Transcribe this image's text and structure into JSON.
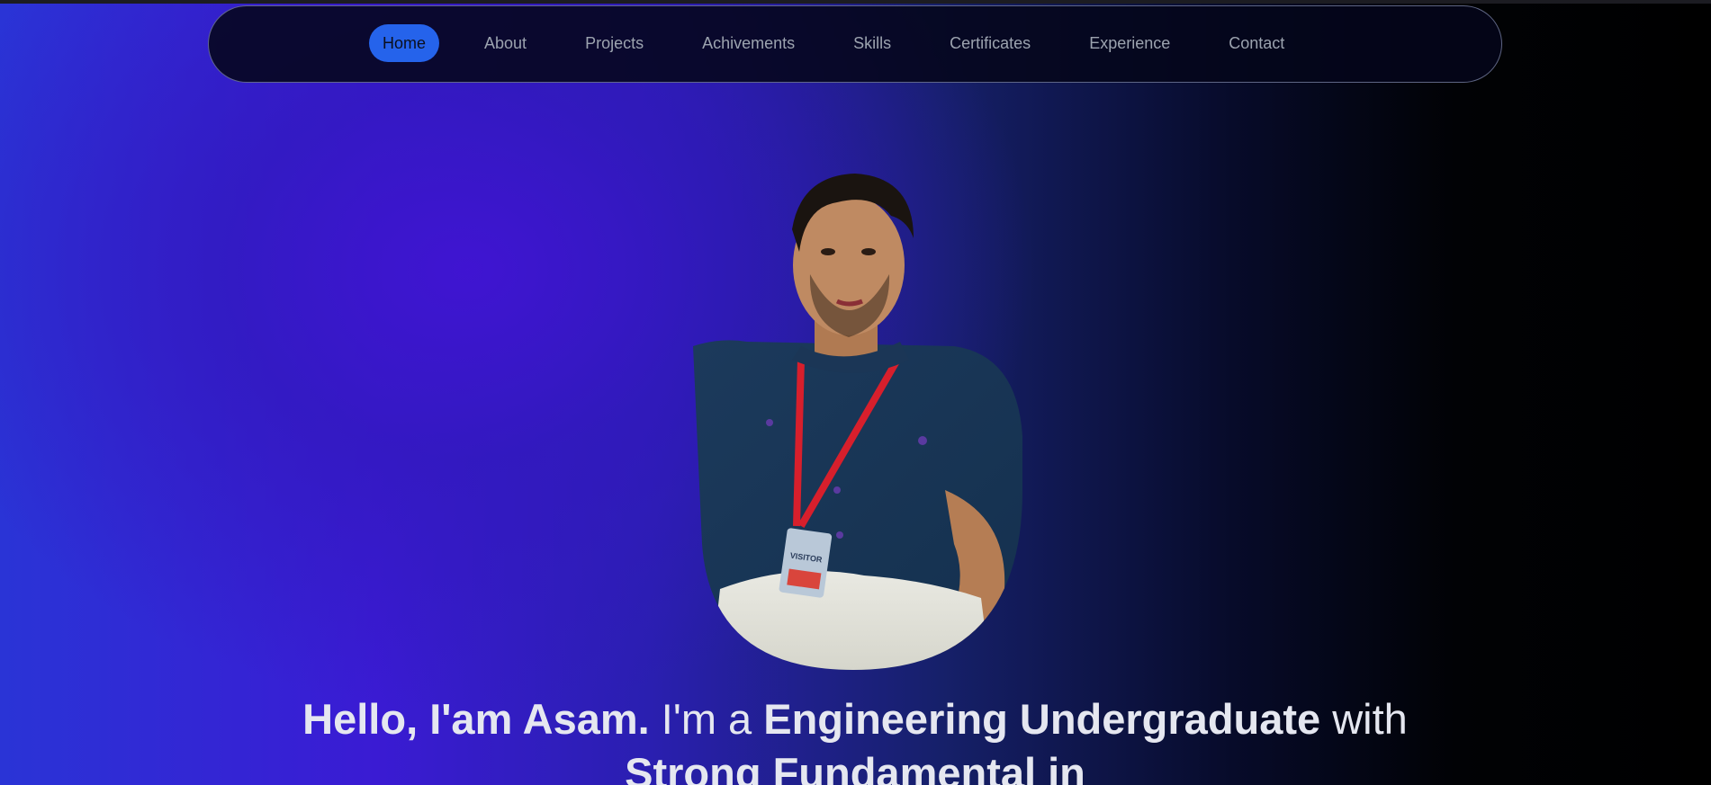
{
  "nav": {
    "items": [
      {
        "label": "Home",
        "active": true
      },
      {
        "label": "About",
        "active": false
      },
      {
        "label": "Projects",
        "active": false
      },
      {
        "label": "Achivements",
        "active": false
      },
      {
        "label": "Skills",
        "active": false
      },
      {
        "label": "Certificates",
        "active": false
      },
      {
        "label": "Experience",
        "active": false
      },
      {
        "label": "Contact",
        "active": false
      }
    ]
  },
  "hero": {
    "portrait_badge": "VISITOR",
    "headline": {
      "part1": "Hello, I'am Asam.",
      "part2": " I'm a ",
      "part3": "Engineering Undergraduate",
      "part4": " with ",
      "part5": "Strong Fundamental in"
    }
  },
  "colors": {
    "accent": "#2563eb",
    "nav_text": "#9ca3af",
    "headline_text": "#e5e7f0"
  }
}
